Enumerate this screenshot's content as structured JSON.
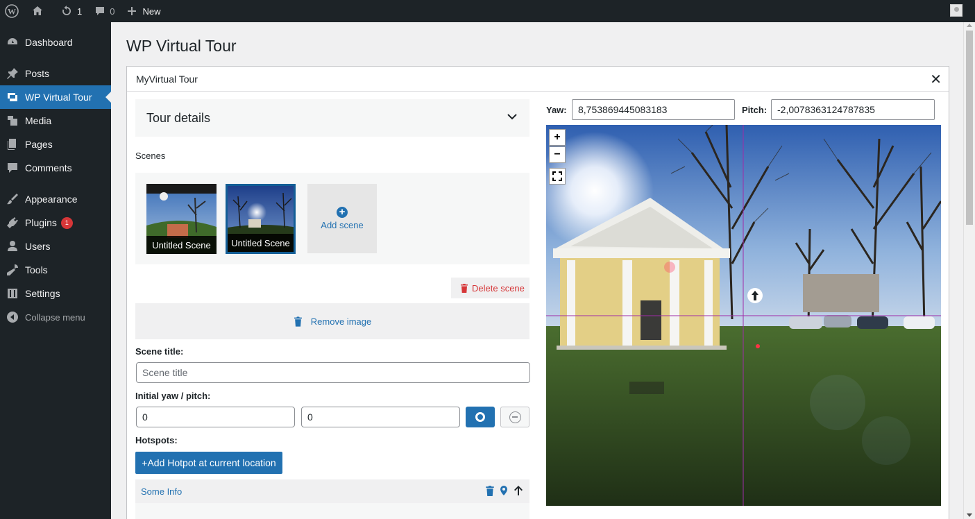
{
  "adminbar": {
    "updates_count": "1",
    "comments_count": "0",
    "new_label": "New"
  },
  "sidebar": {
    "items": [
      {
        "label": "Dashboard",
        "icon": "dashboard-icon"
      },
      {
        "label": "Posts",
        "icon": "pin-icon"
      },
      {
        "label": "WP Virtual Tour",
        "icon": "images-icon"
      },
      {
        "label": "Media",
        "icon": "media-icon"
      },
      {
        "label": "Pages",
        "icon": "pages-icon"
      },
      {
        "label": "Comments",
        "icon": "comment-icon"
      },
      {
        "label": "Appearance",
        "icon": "brush-icon"
      },
      {
        "label": "Plugins",
        "icon": "plug-icon",
        "badge": "1"
      },
      {
        "label": "Users",
        "icon": "user-icon"
      },
      {
        "label": "Tools",
        "icon": "wrench-icon"
      },
      {
        "label": "Settings",
        "icon": "sliders-icon"
      },
      {
        "label": "Collapse menu",
        "icon": "collapse-icon"
      }
    ]
  },
  "page": {
    "title": "WP Virtual Tour"
  },
  "modal": {
    "title": "MyVirtual Tour",
    "close": "✕"
  },
  "editor": {
    "tour_details": "Tour details",
    "scenes_label": "Scenes",
    "scenes": [
      {
        "label": "Untitled Scene",
        "selected": false
      },
      {
        "label": "Untitled Scene",
        "selected": true
      }
    ],
    "add_scene": "Add scene",
    "delete_scene": "Delete scene",
    "remove_image": "Remove image",
    "scene_title_label": "Scene title:",
    "scene_title_placeholder": "Scene title",
    "scene_title_value": "",
    "yaw_pitch_label": "Initial yaw / pitch:",
    "initial_yaw": "0",
    "initial_pitch": "0",
    "hotspots_label": "Hotspots:",
    "add_hotspot": "+Add Hotpot at current location",
    "hotspots": [
      {
        "label": "Some Info"
      }
    ]
  },
  "viewer": {
    "yaw_label": "Yaw:",
    "yaw_value": "8,753869445083183",
    "pitch_label": "Pitch:",
    "pitch_value": "-2,0078363124787835",
    "zoom_in": "+",
    "zoom_out": "−"
  },
  "colors": {
    "admin_dark": "#1d2327",
    "accent": "#2271b1",
    "danger": "#d63638"
  }
}
